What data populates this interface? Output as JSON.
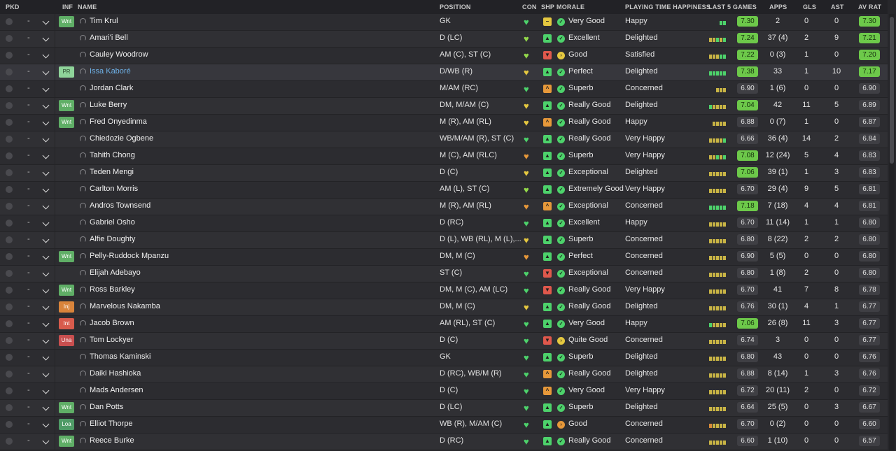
{
  "columns": {
    "pkd": "PKD",
    "inf": "INF",
    "name": "NAME",
    "position": "POSITION",
    "con": "CON",
    "shp": "SHP",
    "morale": "MORALE",
    "playing_time": "PLAYING TIME HAPPINESS",
    "last5": "LAST 5 GAMES",
    "apps": "APPS",
    "gls": "GLS",
    "ast": "AST",
    "av_rat": "AV RAT"
  },
  "colors": {
    "good_green": "#6dc94a",
    "neutral_rating": "#3f3f44",
    "yellow": "#e5c840",
    "orange": "#e6983a",
    "red": "#e0584c"
  },
  "players": [
    {
      "pkd": "-",
      "inf": "Wnt",
      "name": "Tim Krul",
      "position": "GK",
      "con": "green",
      "shp": "yellow",
      "morale_icon": "green",
      "morale": "Very Good",
      "playing_time": "Happy",
      "form": [
        "g",
        "g"
      ],
      "last5": "7.30",
      "last5_hi": true,
      "apps": "2",
      "gls": "0",
      "ast": "0",
      "av_rat": "7.30",
      "av_hi": true
    },
    {
      "pkd": "-",
      "inf": "",
      "name": "Amari'i Bell",
      "position": "D (LC)",
      "con": "lime",
      "shp": "green",
      "morale_icon": "green",
      "morale": "Excellent",
      "playing_time": "Delighted",
      "form": [
        "y",
        "y",
        "g",
        "y",
        "g"
      ],
      "last5": "7.24",
      "last5_hi": true,
      "apps": "37 (4)",
      "gls": "2",
      "ast": "9",
      "av_rat": "7.21",
      "av_hi": true
    },
    {
      "pkd": "-",
      "inf": "",
      "name": "Cauley Woodrow",
      "position": "AM (C), ST (C)",
      "con": "lime",
      "shp": "red",
      "morale_icon": "yellow",
      "morale": "Good",
      "playing_time": "Satisfied",
      "form": [
        "y",
        "y",
        "y",
        "g",
        "g"
      ],
      "last5": "7.22",
      "last5_hi": true,
      "apps": "0 (3)",
      "gls": "1",
      "ast": "0",
      "av_rat": "7.20",
      "av_hi": true
    },
    {
      "pkd": "-",
      "inf": "PR",
      "name": "Issa Kaboré",
      "position": "D/WB (R)",
      "con": "yellow",
      "shp": "green",
      "morale_icon": "green",
      "morale": "Perfect",
      "playing_time": "Delighted",
      "form": [
        "g",
        "g",
        "g",
        "g",
        "g"
      ],
      "last5": "7.38",
      "last5_hi": true,
      "apps": "33",
      "gls": "1",
      "ast": "10",
      "av_rat": "7.17",
      "av_hi": true,
      "link": true
    },
    {
      "pkd": "-",
      "inf": "",
      "name": "Jordan Clark",
      "position": "M/AM (RC)",
      "con": "green",
      "shp": "orange",
      "morale_icon": "green",
      "morale": "Superb",
      "playing_time": "Concerned",
      "form": [
        "y",
        "y",
        "y"
      ],
      "last5": "6.90",
      "last5_hi": false,
      "apps": "1 (6)",
      "gls": "0",
      "ast": "0",
      "av_rat": "6.90",
      "av_hi": false
    },
    {
      "pkd": "-",
      "inf": "Wnt",
      "name": "Luke Berry",
      "position": "DM, M/AM (C)",
      "con": "yellow",
      "shp": "green",
      "morale_icon": "green",
      "morale": "Really Good",
      "playing_time": "Delighted",
      "form": [
        "g",
        "y",
        "y",
        "y",
        "y"
      ],
      "last5": "7.04",
      "last5_hi": true,
      "apps": "42",
      "gls": "11",
      "ast": "5",
      "av_rat": "6.89",
      "av_hi": false
    },
    {
      "pkd": "-",
      "inf": "Wnt",
      "name": "Fred Onyedinma",
      "position": "M (R), AM (RL)",
      "con": "yellow",
      "shp": "orange",
      "morale_icon": "green",
      "morale": "Really Good",
      "playing_time": "Happy",
      "form": [
        "y",
        "y",
        "y",
        "y"
      ],
      "last5": "6.88",
      "last5_hi": false,
      "apps": "0 (7)",
      "gls": "1",
      "ast": "0",
      "av_rat": "6.87",
      "av_hi": false
    },
    {
      "pkd": "-",
      "inf": "",
      "name": "Chiedozie Ogbene",
      "position": "WB/M/AM (R), ST (C)",
      "con": "green",
      "shp": "green",
      "morale_icon": "green",
      "morale": "Really Good",
      "playing_time": "Very Happy",
      "form": [
        "y",
        "y",
        "y",
        "y",
        "g"
      ],
      "last5": "6.66",
      "last5_hi": false,
      "apps": "36 (4)",
      "gls": "14",
      "ast": "2",
      "av_rat": "6.84",
      "av_hi": false
    },
    {
      "pkd": "-",
      "inf": "",
      "name": "Tahith Chong",
      "position": "M (C), AM (RLC)",
      "con": "orange",
      "shp": "green",
      "morale_icon": "green",
      "morale": "Superb",
      "playing_time": "Very Happy",
      "form": [
        "y",
        "y",
        "g",
        "y",
        "g"
      ],
      "last5": "7.08",
      "last5_hi": true,
      "apps": "12 (24)",
      "gls": "5",
      "ast": "4",
      "av_rat": "6.83",
      "av_hi": false
    },
    {
      "pkd": "-",
      "inf": "",
      "name": "Teden Mengi",
      "position": "D (C)",
      "con": "yellow",
      "shp": "green",
      "morale_icon": "green",
      "morale": "Exceptional",
      "playing_time": "Delighted",
      "form": [
        "y",
        "y",
        "y",
        "y",
        "y"
      ],
      "last5": "7.06",
      "last5_hi": true,
      "apps": "39 (1)",
      "gls": "1",
      "ast": "3",
      "av_rat": "6.83",
      "av_hi": false
    },
    {
      "pkd": "-",
      "inf": "",
      "name": "Carlton Morris",
      "position": "AM (L), ST (C)",
      "con": "lime",
      "shp": "green",
      "morale_icon": "green",
      "morale": "Extremely Good",
      "playing_time": "Very Happy",
      "form": [
        "y",
        "y",
        "y",
        "y",
        "y"
      ],
      "last5": "6.70",
      "last5_hi": false,
      "apps": "29 (4)",
      "gls": "9",
      "ast": "5",
      "av_rat": "6.81",
      "av_hi": false
    },
    {
      "pkd": "-",
      "inf": "",
      "name": "Andros Townsend",
      "position": "M (R), AM (RL)",
      "con": "orange",
      "shp": "orange",
      "morale_icon": "green",
      "morale": "Exceptional",
      "playing_time": "Concerned",
      "form": [
        "g",
        "g",
        "g",
        "g",
        "g"
      ],
      "last5": "7.18",
      "last5_hi": true,
      "apps": "7 (18)",
      "gls": "4",
      "ast": "4",
      "av_rat": "6.81",
      "av_hi": false
    },
    {
      "pkd": "-",
      "inf": "",
      "name": "Gabriel Osho",
      "position": "D (RC)",
      "con": "green",
      "shp": "green",
      "morale_icon": "green",
      "morale": "Excellent",
      "playing_time": "Happy",
      "form": [
        "y",
        "y",
        "y",
        "y",
        "y"
      ],
      "last5": "6.70",
      "last5_hi": false,
      "apps": "11 (14)",
      "gls": "1",
      "ast": "1",
      "av_rat": "6.80",
      "av_hi": false
    },
    {
      "pkd": "-",
      "inf": "",
      "name": "Alfie Doughty",
      "position": "D (L), WB (RL), M (L),...",
      "con": "yellow",
      "shp": "green",
      "morale_icon": "green",
      "morale": "Superb",
      "playing_time": "Concerned",
      "form": [
        "y",
        "y",
        "y",
        "y",
        "y"
      ],
      "last5": "6.80",
      "last5_hi": false,
      "apps": "8 (22)",
      "gls": "2",
      "ast": "2",
      "av_rat": "6.80",
      "av_hi": false
    },
    {
      "pkd": "-",
      "inf": "Wnt",
      "name": "Pelly-Ruddock Mpanzu",
      "position": "DM, M (C)",
      "con": "orange",
      "shp": "green",
      "morale_icon": "green",
      "morale": "Perfect",
      "playing_time": "Concerned",
      "form": [
        "y",
        "y",
        "y",
        "y",
        "y"
      ],
      "last5": "6.90",
      "last5_hi": false,
      "apps": "5 (5)",
      "gls": "0",
      "ast": "0",
      "av_rat": "6.80",
      "av_hi": false
    },
    {
      "pkd": "-",
      "inf": "",
      "name": "Elijah Adebayo",
      "position": "ST (C)",
      "con": "green",
      "shp": "red",
      "morale_icon": "green",
      "morale": "Exceptional",
      "playing_time": "Concerned",
      "form": [
        "y",
        "y",
        "y",
        "y",
        "y"
      ],
      "last5": "6.80",
      "last5_hi": false,
      "apps": "1 (8)",
      "gls": "2",
      "ast": "0",
      "av_rat": "6.80",
      "av_hi": false
    },
    {
      "pkd": "-",
      "inf": "Wnt",
      "name": "Ross Barkley",
      "position": "DM, M (C), AM (LC)",
      "con": "green",
      "shp": "red",
      "morale_icon": "green",
      "morale": "Really Good",
      "playing_time": "Very Happy",
      "form": [
        "y",
        "y",
        "y",
        "y",
        "y"
      ],
      "last5": "6.70",
      "last5_hi": false,
      "apps": "41",
      "gls": "7",
      "ast": "8",
      "av_rat": "6.78",
      "av_hi": false
    },
    {
      "pkd": "-",
      "inf": "Inj",
      "name": "Marvelous Nakamba",
      "position": "DM, M (C)",
      "con": "yellow",
      "shp": "green",
      "morale_icon": "green",
      "morale": "Really Good",
      "playing_time": "Delighted",
      "form": [
        "y",
        "y",
        "y",
        "y",
        "y"
      ],
      "last5": "6.76",
      "last5_hi": false,
      "apps": "30 (1)",
      "gls": "4",
      "ast": "1",
      "av_rat": "6.77",
      "av_hi": false
    },
    {
      "pkd": "-",
      "inf": "Int",
      "name": "Jacob Brown",
      "position": "AM (RL), ST (C)",
      "con": "green",
      "shp": "green",
      "morale_icon": "green",
      "morale": "Very Good",
      "playing_time": "Happy",
      "form": [
        "g",
        "y",
        "y",
        "y",
        "y"
      ],
      "last5": "7.06",
      "last5_hi": true,
      "apps": "26 (8)",
      "gls": "11",
      "ast": "3",
      "av_rat": "6.77",
      "av_hi": false
    },
    {
      "pkd": "-",
      "inf": "Una",
      "name": "Tom Lockyer",
      "position": "D (C)",
      "con": "green",
      "shp": "red",
      "morale_icon": "yellow",
      "morale": "Quite Good",
      "playing_time": "Concerned",
      "form": [
        "y",
        "y",
        "y",
        "y",
        "y"
      ],
      "last5": "6.74",
      "last5_hi": false,
      "apps": "3",
      "gls": "0",
      "ast": "0",
      "av_rat": "6.77",
      "av_hi": false
    },
    {
      "pkd": "-",
      "inf": "",
      "name": "Thomas Kaminski",
      "position": "GK",
      "con": "green",
      "shp": "green",
      "morale_icon": "green",
      "morale": "Superb",
      "playing_time": "Delighted",
      "form": [
        "y",
        "y",
        "y",
        "y",
        "y"
      ],
      "last5": "6.80",
      "last5_hi": false,
      "apps": "43",
      "gls": "0",
      "ast": "0",
      "av_rat": "6.76",
      "av_hi": false
    },
    {
      "pkd": "-",
      "inf": "",
      "name": "Daiki Hashioka",
      "position": "D (RC), WB/M (R)",
      "con": "green",
      "shp": "orange",
      "morale_icon": "green",
      "morale": "Really Good",
      "playing_time": "Delighted",
      "form": [
        "y",
        "y",
        "y",
        "y",
        "y"
      ],
      "last5": "6.88",
      "last5_hi": false,
      "apps": "8 (14)",
      "gls": "1",
      "ast": "3",
      "av_rat": "6.76",
      "av_hi": false
    },
    {
      "pkd": "-",
      "inf": "",
      "name": "Mads Andersen",
      "position": "D (C)",
      "con": "green",
      "shp": "orange",
      "morale_icon": "green",
      "morale": "Very Good",
      "playing_time": "Very Happy",
      "form": [
        "y",
        "y",
        "y",
        "y",
        "y"
      ],
      "last5": "6.72",
      "last5_hi": false,
      "apps": "20 (11)",
      "gls": "2",
      "ast": "0",
      "av_rat": "6.72",
      "av_hi": false
    },
    {
      "pkd": "-",
      "inf": "Wnt",
      "name": "Dan Potts",
      "position": "D (LC)",
      "con": "green",
      "shp": "green",
      "morale_icon": "green",
      "morale": "Superb",
      "playing_time": "Delighted",
      "form": [
        "y",
        "y",
        "y",
        "y",
        "y"
      ],
      "last5": "6.64",
      "last5_hi": false,
      "apps": "25 (5)",
      "gls": "0",
      "ast": "3",
      "av_rat": "6.67",
      "av_hi": false
    },
    {
      "pkd": "-",
      "inf": "Loa",
      "name": "Elliot Thorpe",
      "position": "WB (R), M/AM (C)",
      "con": "green",
      "shp": "green",
      "morale_icon": "orange",
      "morale": "Good",
      "playing_time": "Concerned",
      "form": [
        "o",
        "y",
        "y",
        "y",
        "y"
      ],
      "last5": "6.70",
      "last5_hi": false,
      "apps": "0 (2)",
      "gls": "0",
      "ast": "0",
      "av_rat": "6.60",
      "av_hi": false
    },
    {
      "pkd": "-",
      "inf": "Wnt",
      "name": "Reece Burke",
      "position": "D (RC)",
      "con": "green",
      "shp": "green",
      "morale_icon": "green",
      "morale": "Really Good",
      "playing_time": "Concerned",
      "form": [
        "y",
        "y",
        "y",
        "y",
        "y"
      ],
      "last5": "6.60",
      "last5_hi": false,
      "apps": "1 (10)",
      "gls": "0",
      "ast": "0",
      "av_rat": "6.57",
      "av_hi": false
    }
  ]
}
